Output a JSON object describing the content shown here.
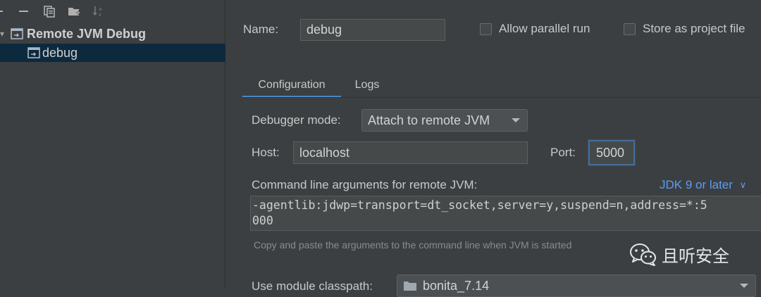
{
  "tree": {
    "group_label": "Remote JVM Debug",
    "item_label": "debug"
  },
  "name_row": {
    "name_label": "Name:",
    "name_value": "debug",
    "allow_parallel_label": "Allow parallel run",
    "store_project_label": "Store as project file"
  },
  "tabs": [
    {
      "label": "Configuration"
    },
    {
      "label": "Logs"
    }
  ],
  "config": {
    "debugger_mode_label": "Debugger mode:",
    "debugger_mode_value": "Attach to remote JVM",
    "host_label": "Host:",
    "host_value": "localhost",
    "port_label": "Port:",
    "port_value": "5000",
    "cmd_label": "Command line arguments for remote JVM:",
    "jdk_link": "JDK 9 or later",
    "cmd_line1": "-agentlib:jdwp=transport=dt_socket,server=y,suspend=n,address=*:5",
    "cmd_line2": "000",
    "hint": "Copy and paste the arguments to the command line when JVM is started",
    "module_label": "Use module classpath:",
    "module_value": "bonita_7.14"
  },
  "watermark": "且听安全",
  "colors": {
    "background": "#3c3f41",
    "selection": "#0d293e",
    "accent": "#4a88c7",
    "link": "#589df6"
  }
}
